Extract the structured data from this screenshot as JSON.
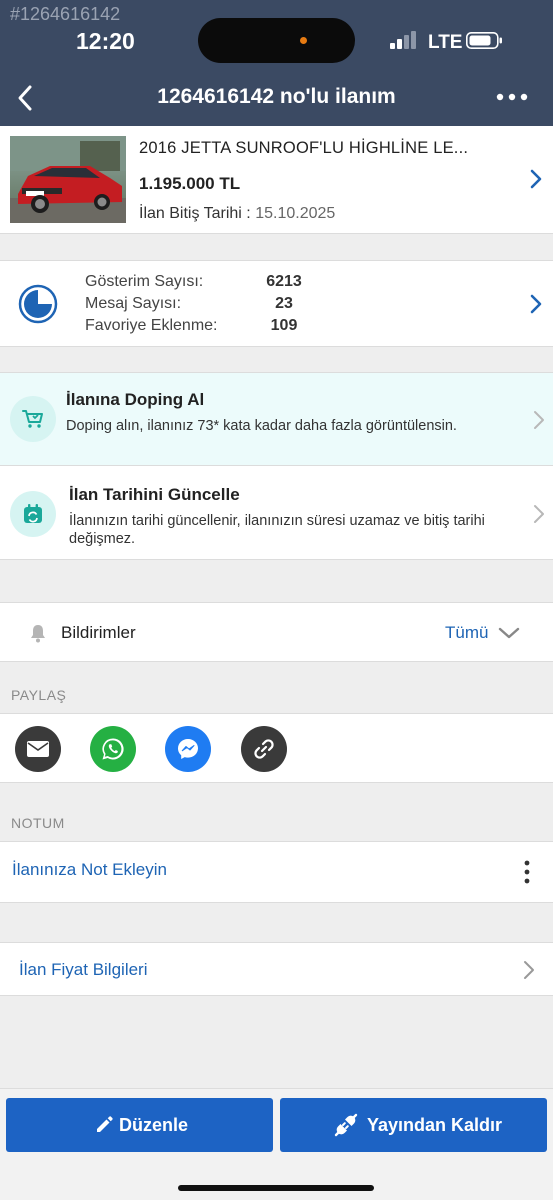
{
  "status_bar": {
    "listing_watermark": "#1264616142",
    "time": "12:20",
    "network": "LTE"
  },
  "nav": {
    "title": "1264616142 no'lu ilanım",
    "back_icon": "chevron-left-icon",
    "more_icon": "more-horizontal-icon"
  },
  "listing": {
    "title": "2016 JETTA SUNROOF'LU HİGHLİNE LE...",
    "price": "1.195.000 TL",
    "end_date_label": "İlan Bitiş Tarihi :",
    "end_date": "15.10.2025",
    "image": "red-volkswagen-jetta-photo"
  },
  "stats": {
    "rows": [
      {
        "label": "Gösterim Sayısı:",
        "value": "6213"
      },
      {
        "label": "Mesaj Sayısı:",
        "value": "23"
      },
      {
        "label": "Favoriye Eklenme:",
        "value": "109"
      }
    ]
  },
  "features": {
    "doping": {
      "title": "İlanına Doping Al",
      "desc": "Doping alın, ilanınız 73* kata kadar daha fazla görüntülensin."
    },
    "update_date": {
      "title": "İlan Tarihini Güncelle",
      "desc": "İlanınızın tarihi güncellenir, ilanınızın süresi uzamaz ve bitiş tarihi değişmez."
    }
  },
  "notifications": {
    "label": "Bildirimler",
    "value": "Tümü"
  },
  "share": {
    "section_label": "PAYLAŞ",
    "buttons": [
      "mail-icon",
      "whatsapp-icon",
      "messenger-icon",
      "link-icon"
    ]
  },
  "note": {
    "section_label": "NOTUM",
    "add_label": "İlanınıza Not Ekleyin"
  },
  "price_info": {
    "label": "İlan Fiyat Bilgileri"
  },
  "actions": {
    "edit_label": "Düzenle",
    "unpublish_label": "Yayından Kaldır"
  },
  "colors": {
    "header_bg": "#3b4a63",
    "accent_blue": "#1e64b4",
    "button_blue": "#1d63c4",
    "doping_bg": "#ecfbfb",
    "icon_teal": "#1aa89a",
    "whatsapp": "#25b043",
    "messenger": "#1f7cf2"
  }
}
